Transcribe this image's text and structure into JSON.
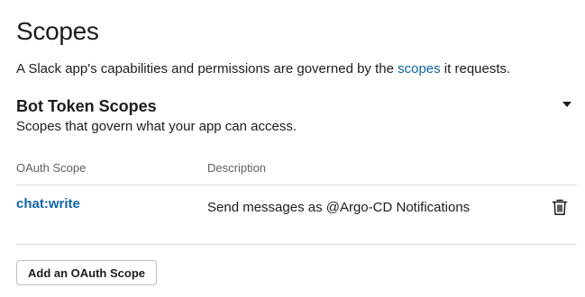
{
  "page": {
    "title": "Scopes"
  },
  "intro": {
    "before_link": "A Slack app's capabilities and permissions are governed by the ",
    "link_text": "scopes",
    "after_link": " it requests."
  },
  "bot_token_scopes": {
    "title": "Bot Token Scopes",
    "subtitle": "Scopes that govern what your app can access.",
    "columns": {
      "scope": "OAuth Scope",
      "description": "Description"
    },
    "rows": [
      {
        "scope": "chat:write",
        "description": "Send messages as @Argo-CD Notifications",
        "remove_icon": "trash-icon"
      }
    ],
    "collapse_icon": "caret-down-icon",
    "add_button_label": "Add an OAuth Scope"
  },
  "colors": {
    "text": "#1d1c1d",
    "link": "#1264a3",
    "muted": "#616061",
    "divider": "#dddddd",
    "button_border": "#bbbbbb"
  }
}
